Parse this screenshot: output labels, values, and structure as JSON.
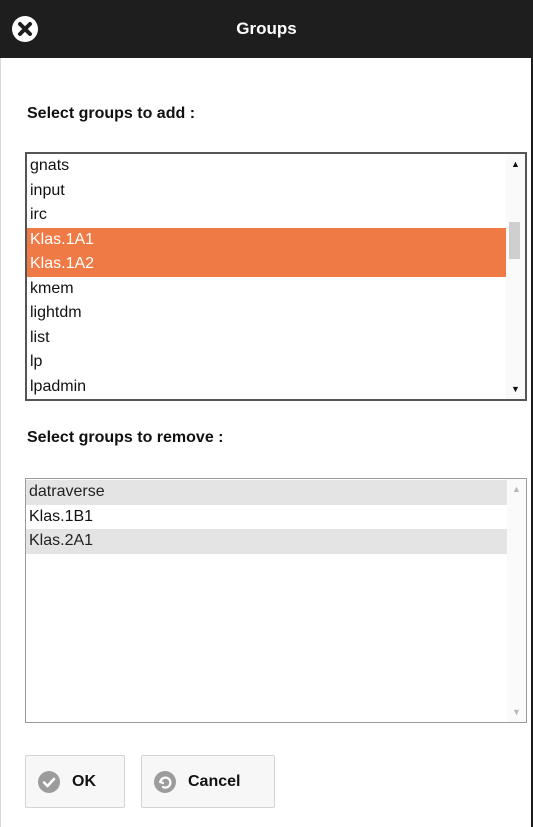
{
  "dialog": {
    "title": "Groups",
    "close_icon": "close-icon"
  },
  "add_section": {
    "label": "Select groups to add :",
    "items": [
      {
        "text": "gnats",
        "selected": false
      },
      {
        "text": "input",
        "selected": false
      },
      {
        "text": "irc",
        "selected": false
      },
      {
        "text": "Klas.1A1",
        "selected": true
      },
      {
        "text": "Klas.1A2",
        "selected": true
      },
      {
        "text": "kmem",
        "selected": false
      },
      {
        "text": "lightdm",
        "selected": false
      },
      {
        "text": "list",
        "selected": false
      },
      {
        "text": "lp",
        "selected": false
      },
      {
        "text": "lpadmin",
        "selected": false
      }
    ]
  },
  "remove_section": {
    "label": "Select groups to remove :",
    "items": [
      {
        "text": "datraverse",
        "highlighted": true
      },
      {
        "text": "Klas.1B1",
        "highlighted": false
      },
      {
        "text": "Klas.2A1",
        "highlighted": true
      }
    ]
  },
  "buttons": {
    "ok_label": "OK",
    "ok_icon": "check-circle-icon",
    "cancel_label": "Cancel",
    "cancel_icon": "undo-circle-icon"
  },
  "colors": {
    "titlebar": "#1e1e1e",
    "selection": "#ef7a45",
    "alt_highlight": "#e4e4e4"
  }
}
